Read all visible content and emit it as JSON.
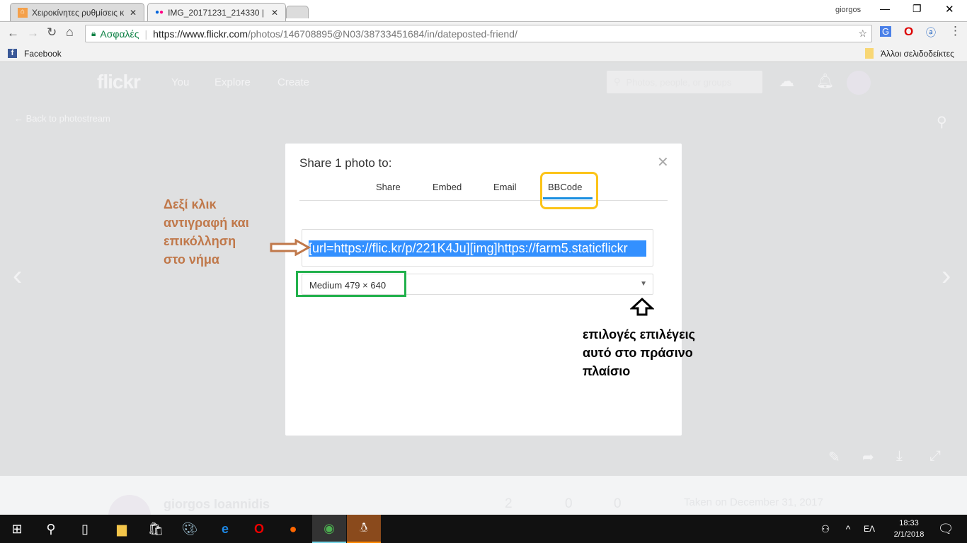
{
  "browser": {
    "tabs": [
      {
        "title": "Χειροκίνητες ρυθμίσεις κ"
      },
      {
        "title": "IMG_20171231_214330 |"
      }
    ],
    "profile": "giorgos",
    "secure_label": "Ασφαλές",
    "url_host": "https://www.flickr.com",
    "url_path": "/photos/146708895@N03/38733451684/in/dateposted-friend/",
    "bookmarks": [
      {
        "label": "Facebook"
      }
    ],
    "other_bookmarks": "Άλλοι σελιδοδείκτες"
  },
  "flickr": {
    "logo": "flickr",
    "nav": [
      "You",
      "Explore",
      "Create"
    ],
    "search_placeholder": "Photos, people, or groups",
    "back_label": "Back to photostream",
    "owner": "giorgos Ioannidis",
    "stats": [
      {
        "value": "2"
      },
      {
        "value": "0"
      },
      {
        "value": "0"
      }
    ],
    "taken": "Taken on December 31, 2017"
  },
  "modal": {
    "title": "Share 1 photo to:",
    "tabs": [
      "Share",
      "Embed",
      "Email",
      "BBCode"
    ],
    "active_tab": "BBCode",
    "code": "[url=https://flic.kr/p/221K4Ju][img]https://farm5.staticflickr",
    "size_select": "Medium 479 × 640"
  },
  "annotations": {
    "left": [
      "Δεξί κλικ",
      "αντιγραφή και",
      "επικόλληση",
      "στο νήμα"
    ],
    "right": [
      "επιλογές επιλέγεις",
      "αυτό στο πράσινο",
      "πλαίσιο"
    ],
    "colors": {
      "orange": "#c0784a",
      "yellow": "#fcc419",
      "green": "#22b14c"
    }
  },
  "taskbar": {
    "lang": "ΕΛ",
    "time": "18:33",
    "date": "2/1/2018"
  }
}
